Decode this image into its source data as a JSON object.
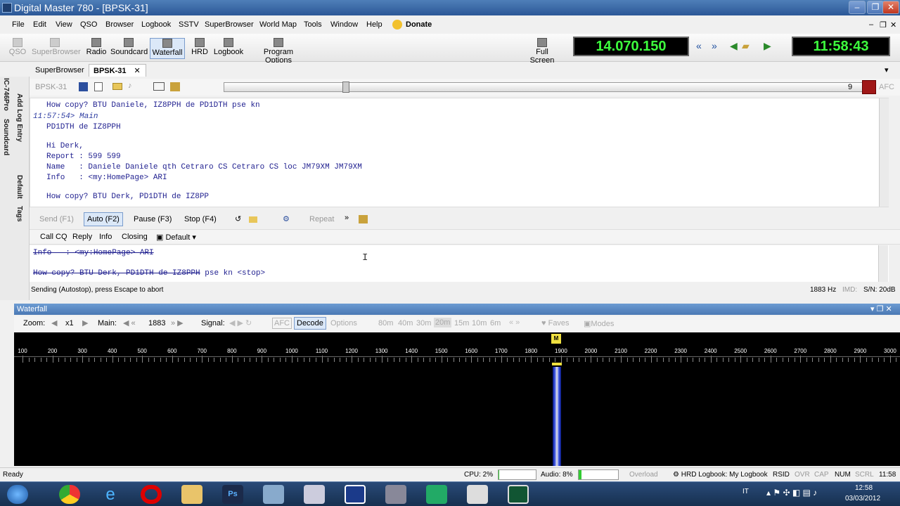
{
  "window": {
    "title": "Digital Master 780 - [BPSK-31]",
    "min": "–",
    "max": "❐",
    "close": "✕"
  },
  "menu": [
    "File",
    "Edit",
    "View",
    "QSO",
    "Browser",
    "Logbook",
    "SSTV",
    "SuperBrowser",
    "World Map",
    "Tools",
    "Window",
    "Help",
    "Donate"
  ],
  "toolbar": {
    "qso": "QSO",
    "superbrowser": "SuperBrowser",
    "radio": "Radio",
    "soundcard": "Soundcard",
    "waterfall": "Waterfall",
    "hrd": "HRD",
    "logbook": "Logbook",
    "program_options": "Program Options",
    "full_screen": "Full Screen",
    "frequency": "14.070.150",
    "clock": "11:58:43"
  },
  "tabs": [
    "SuperBrowser",
    "BPSK-31"
  ],
  "sidebar": [
    "IC-746Pro",
    "Add Log Entry",
    "Soundcard",
    "Default",
    "Tags"
  ],
  "bpsk": {
    "mode": "BPSK-31",
    "count": "9",
    "afc": "AFC"
  },
  "rx_lines": [
    "How copy? BTU Daniele, IZ8PPH de PD1DTH pse kn",
    "PD1DTH de IZ8PPH",
    "Hi Derk,",
    "Report : 599 599",
    "Name   : Daniele Daniele qth Cetraro CS Cetraro CS loc JM79XM JM79XM",
    "Info   : <my:HomePage> ARI",
    "How copy? BTU Derk, PD1DTH de IZ8PP"
  ],
  "rx_ts": "11:57:54> Main",
  "controls": {
    "send": "Send (F1)",
    "auto": "Auto (F2)",
    "pause": "Pause (F3)",
    "stop": "Stop (F4)",
    "repeat": "Repeat"
  },
  "macros": [
    "Call CQ",
    "Reply",
    "Info",
    "Closing",
    "Default"
  ],
  "tx": {
    "line1": "Info   : <my:HomePage> ARI",
    "line2_sent": "How copy? BTU Derk, PD1DTH de IZ8PPH",
    "line2_rest": " pse kn <stop>"
  },
  "status1": {
    "msg": "Sending (Autostop), press Escape to abort",
    "hz": "1883 Hz",
    "imd": "IMD:",
    "sn": "S/N: 20dB"
  },
  "waterfall": {
    "title": "Waterfall",
    "zoom_label": "Zoom:",
    "zoom": "x1",
    "main_label": "Main:",
    "main": "1883",
    "signal_label": "Signal:",
    "afc": "AFC",
    "decode": "Decode",
    "options": "Options",
    "bands": [
      "80m",
      "40m",
      "30m",
      "20m",
      "15m",
      "10m",
      "6m"
    ],
    "faves": "Faves",
    "modes": "Modes",
    "scale": [
      "100",
      "200",
      "300",
      "400",
      "500",
      "600",
      "700",
      "800",
      "900",
      "1000",
      "1100",
      "1200",
      "1300",
      "1400",
      "1500",
      "1600",
      "1700",
      "1800",
      "1900",
      "2000",
      "2100",
      "2200",
      "2300",
      "2400",
      "2500",
      "2600",
      "2700",
      "2800",
      "2900",
      "3000"
    ],
    "marker": "M"
  },
  "statusbar": {
    "ready": "Ready",
    "cpu": "CPU: 2%",
    "audio": "Audio: 8%",
    "overload": "Overload",
    "logbook": "HRD Logbook: My Logbook",
    "rsid": "RSID",
    "ovr": "OVR",
    "cap": "CAP",
    "num": "NUM",
    "scrl": "SCRL",
    "time": "11:58"
  },
  "taskbar": {
    "lang": "IT",
    "time": "12:58",
    "date": "03/03/2012"
  }
}
